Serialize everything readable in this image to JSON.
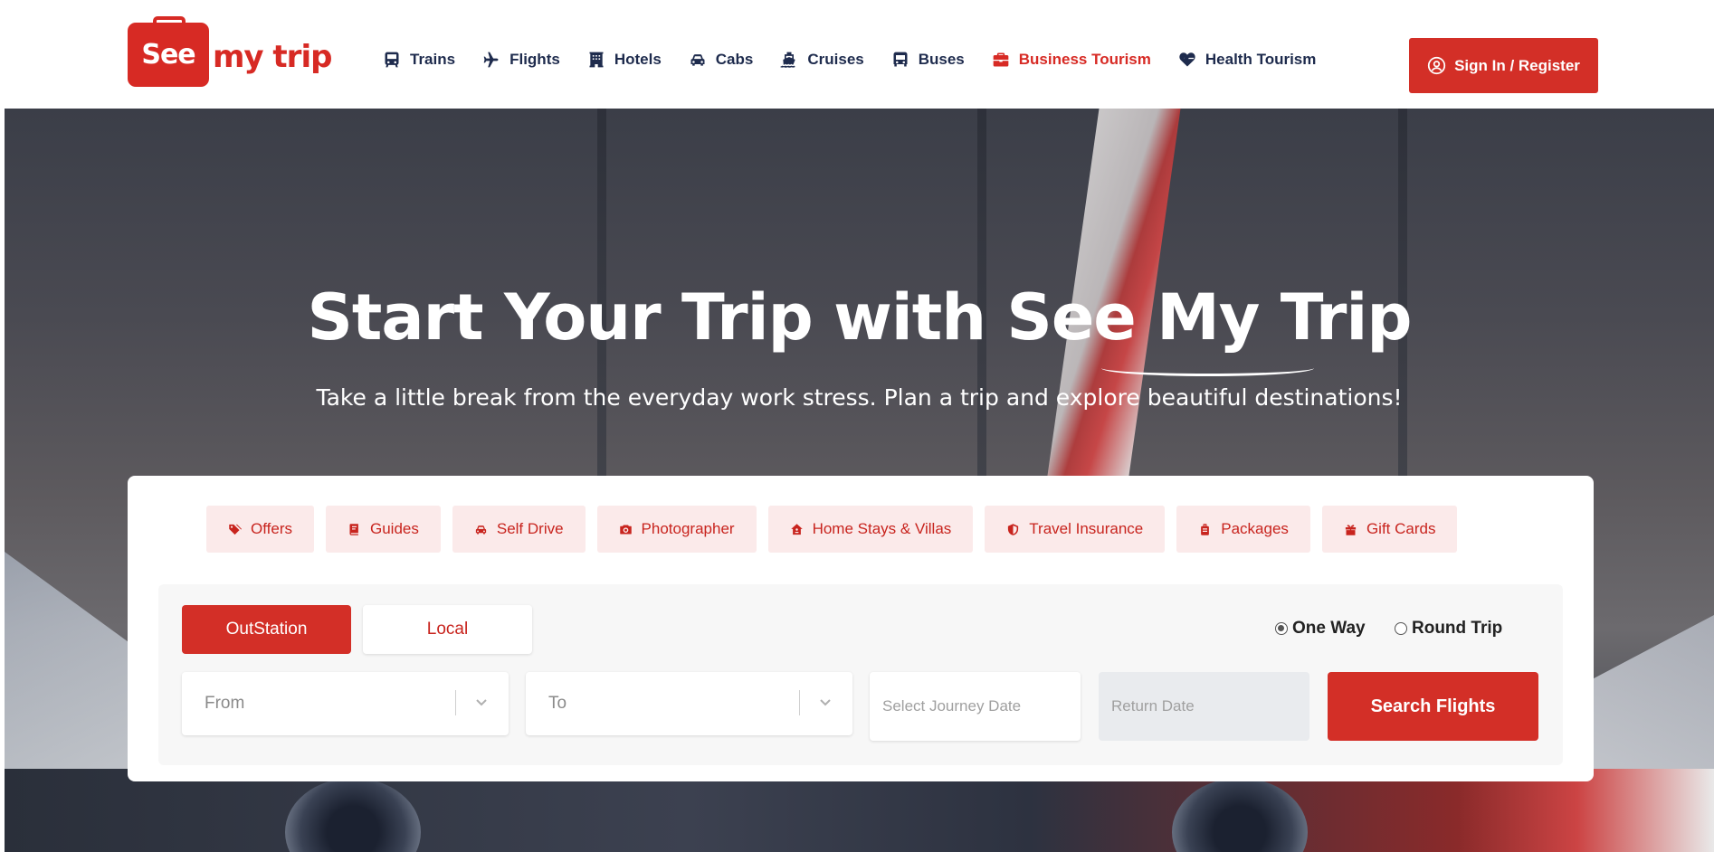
{
  "brand": {
    "logo_box": "See",
    "logo_text": "my trip",
    "color": "#d72a24"
  },
  "nav": {
    "items": [
      {
        "label": "Trains",
        "icon": "train-icon"
      },
      {
        "label": "Flights",
        "icon": "plane-icon"
      },
      {
        "label": "Hotels",
        "icon": "hotel-icon"
      },
      {
        "label": "Cabs",
        "icon": "car-icon"
      },
      {
        "label": "Cruises",
        "icon": "ship-icon"
      },
      {
        "label": "Buses",
        "icon": "bus-icon"
      },
      {
        "label": "Business Tourism",
        "icon": "briefcase-icon",
        "active": true
      },
      {
        "label": "Health Tourism",
        "icon": "heart-pulse-icon"
      }
    ],
    "signin_label": "Sign In / Register"
  },
  "hero": {
    "title": "Start Your Trip with See My Trip",
    "subtitle": "Take a little break from the everyday work stress. Plan a trip and explore beautiful destinations!"
  },
  "services": [
    {
      "label": "Offers",
      "icon": "tags-icon"
    },
    {
      "label": "Guides",
      "icon": "book-icon"
    },
    {
      "label": "Self Drive",
      "icon": "car-icon"
    },
    {
      "label": "Photographer",
      "icon": "camera-icon"
    },
    {
      "label": "Home Stays & Villas",
      "icon": "home-icon"
    },
    {
      "label": "Travel Insurance",
      "icon": "shield-icon"
    },
    {
      "label": "Packages",
      "icon": "luggage-icon"
    },
    {
      "label": "Gift Cards",
      "icon": "gift-icon"
    }
  ],
  "search": {
    "tabs": {
      "outstation": "OutStation",
      "local": "Local"
    },
    "trip_type": {
      "one_way": "One Way",
      "round_trip": "Round Trip",
      "selected": "One Way"
    },
    "from_placeholder": "From",
    "to_placeholder": "To",
    "journey_date_placeholder": "Select Journey Date",
    "return_date_placeholder": "Return Date",
    "search_button": "Search Flights"
  },
  "colors": {
    "accent": "#d32f27",
    "chip_bg": "#fbeaea",
    "nav_text": "#1e2b4d"
  }
}
